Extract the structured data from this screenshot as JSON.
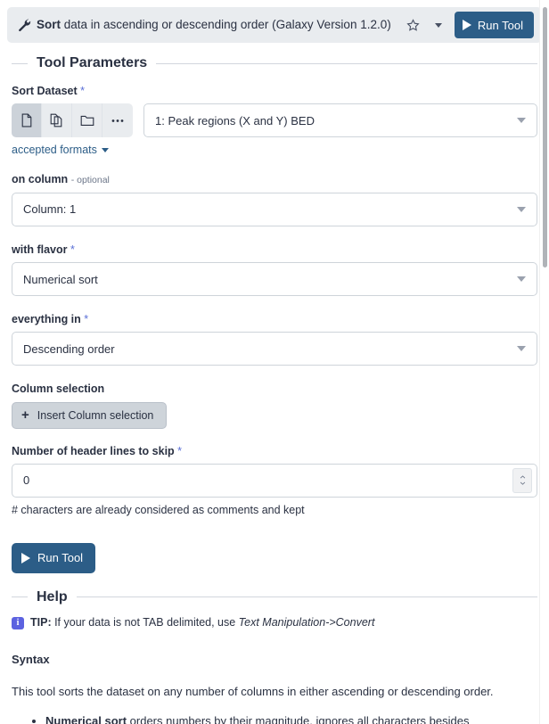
{
  "header": {
    "icon": "wrench-icon",
    "title_bold": "Sort",
    "title_rest": " data in ascending or descending order (Galaxy Version 1.2.0)",
    "favorite_icon": "star-outline-icon",
    "options_icon": "caret-down-icon",
    "run_label": "Run Tool",
    "accent_color": "#2c5d87",
    "bar_color": "#e9ecef"
  },
  "sections": {
    "parameters_title": "Tool Parameters",
    "help_title": "Help"
  },
  "fields": {
    "dataset": {
      "label": "Sort Dataset",
      "required_mark": "*",
      "modes": [
        {
          "name": "single-dataset-icon",
          "active": true
        },
        {
          "name": "multiple-datasets-icon",
          "active": false
        },
        {
          "name": "dataset-collection-icon",
          "active": false
        },
        {
          "name": "more-options-icon",
          "active": false
        }
      ],
      "value": "1: Peak regions (X and Y) BED",
      "accepted_formats_label": "accepted formats"
    },
    "on_column": {
      "label": "on column",
      "optional_tag": "- optional",
      "value": "Column: 1"
    },
    "flavor": {
      "label": "with flavor",
      "required_mark": "*",
      "value": "Numerical sort"
    },
    "order": {
      "label": "everything in",
      "required_mark": "*",
      "value": "Descending order"
    },
    "column_selection": {
      "label": "Column selection",
      "insert_label": "Insert Column selection",
      "insert_icon": "plus-icon"
    },
    "header_lines": {
      "label": "Number of header lines to skip",
      "required_mark": "*",
      "value": "0",
      "note": "# characters are already considered as comments and kept",
      "stepper_up_icon": "chevron-up-icon",
      "stepper_down_icon": "chevron-down-icon"
    }
  },
  "actions": {
    "run_tool_label": "Run Tool",
    "play_icon": "play-icon"
  },
  "help": {
    "tip_icon": "info-icon",
    "tip_bold": "TIP:",
    "tip_text": " If your data is not TAB delimited, use ",
    "tip_italic": "Text Manipulation->Convert",
    "syntax_heading": "Syntax",
    "syntax_paragraph": "This tool sorts the dataset on any number of columns in either ascending or descending order.",
    "bullets": [
      {
        "bold": "Numerical sort",
        "text": " orders numbers by their magnitude, ignores all characters besides"
      }
    ]
  },
  "scrollbar": {
    "name": "vertical-scrollbar"
  }
}
